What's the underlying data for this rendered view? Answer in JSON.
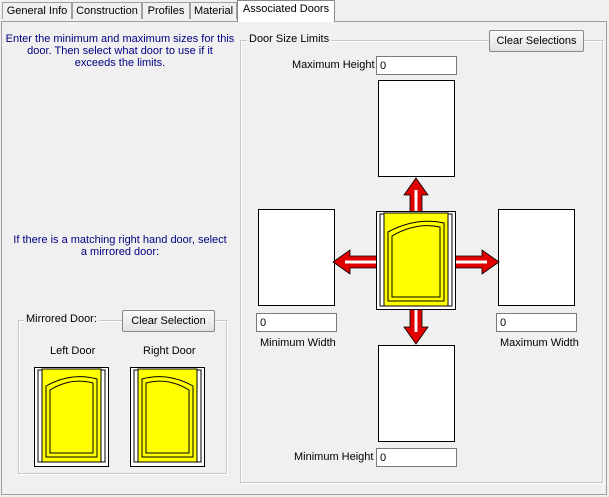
{
  "tabs": [
    {
      "label": "General Info"
    },
    {
      "label": "Construction"
    },
    {
      "label": "Profiles"
    },
    {
      "label": "Material"
    },
    {
      "label": "Associated Doors"
    }
  ],
  "instructions": {
    "size_line1": "Enter the minimum and maximum sizes for this",
    "size_line2": "door.  Then select what door to use if it",
    "size_line3": "exceeds the limits.",
    "mirror_line1": "If there is a matching right hand door, select",
    "mirror_line2": "a mirrored door:"
  },
  "mirrored": {
    "group_label": "Mirrored Door:",
    "clear_button": "Clear Selection",
    "left_label": "Left Door",
    "right_label": "Right Door"
  },
  "limits": {
    "group_label": "Door Size Limits",
    "clear_button": "Clear Selections",
    "max_height_label": "Maximum Height",
    "max_height_value": "0",
    "min_width_label": "Minimum Width",
    "min_width_value": "0",
    "max_width_label": "Maximum Width",
    "max_width_value": "0",
    "min_height_label": "Minimum Height",
    "min_height_value": "0"
  },
  "colors": {
    "door_panel": "#ffff00",
    "arrow": "#e00000",
    "instruction_text": "#000080"
  }
}
